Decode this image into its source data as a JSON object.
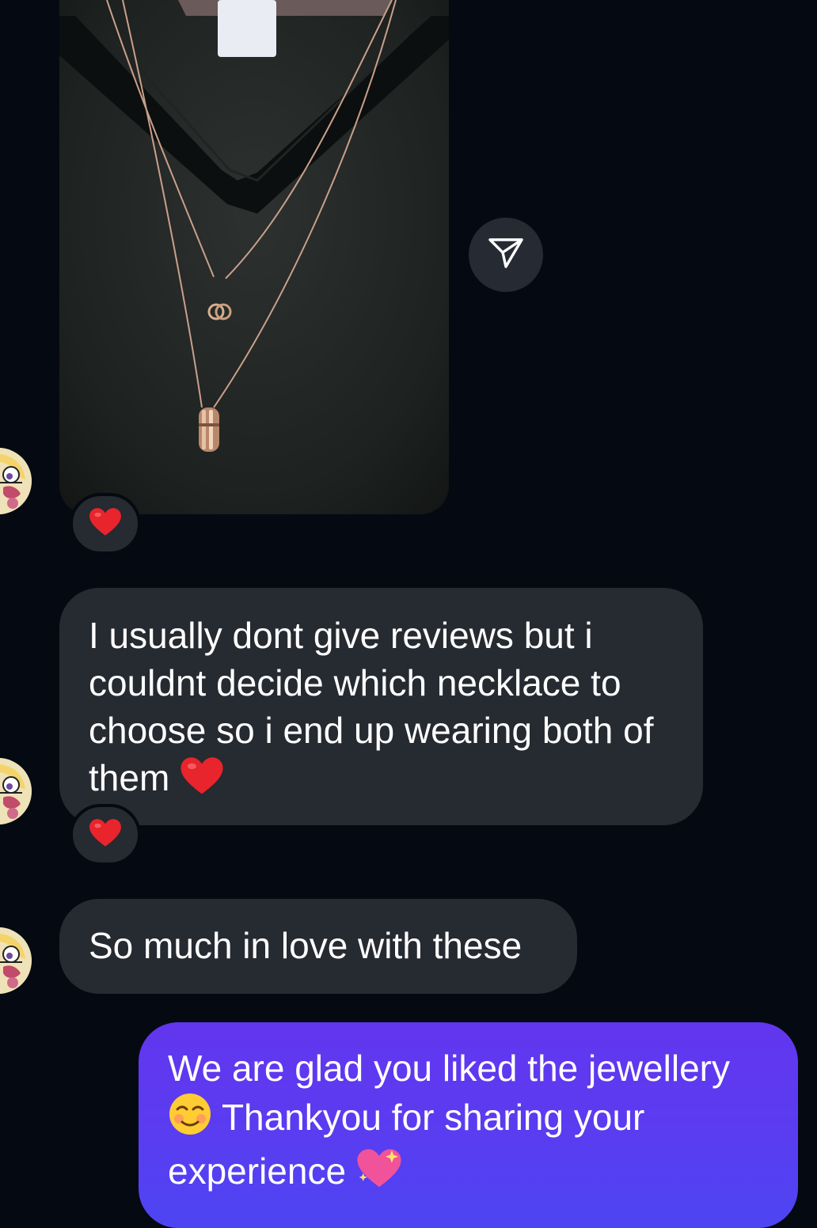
{
  "thread": {
    "messages": [
      {
        "sender": "them",
        "type": "image",
        "image_description": "",
        "reaction": "❤️"
      },
      {
        "sender": "them",
        "type": "text",
        "text": "I usually dont give reviews but i couldnt decide which necklace to choose so i end up wearing both of them",
        "emoji": "❤️",
        "reaction": "❤️"
      },
      {
        "sender": "them",
        "type": "text",
        "text": "So much in love with these"
      },
      {
        "sender": "me",
        "type": "text",
        "text_part1": "We are glad you liked the jewellery",
        "emoji1": "☺️",
        "text_part2": "Thankyou for sharing your experience",
        "emoji2": "💖"
      }
    ]
  },
  "icons": {
    "share": "paper-plane-icon",
    "avatar": "contact-avatar",
    "heart": "red-heart-icon",
    "smile": "smiling-face-icon",
    "sparkle_heart": "sparkling-heart-icon"
  },
  "colors": {
    "background": "#050a12",
    "received_bubble": "#262a31",
    "sent_bubble_top": "#6236ee",
    "sent_bubble_bottom": "#4d45f2",
    "heart": "#e8242c"
  }
}
